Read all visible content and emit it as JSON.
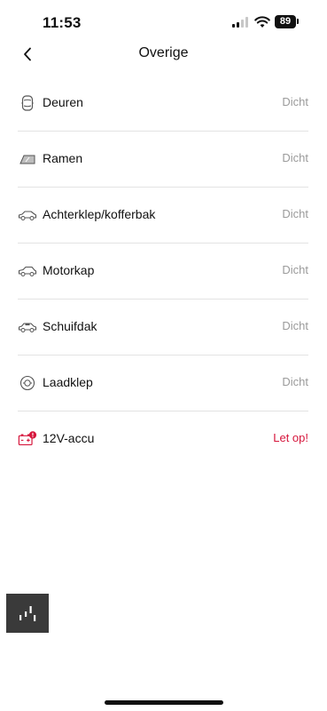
{
  "status_bar": {
    "time": "11:53",
    "battery": "89"
  },
  "header": {
    "title": "Overige"
  },
  "items": [
    {
      "label": "Deuren",
      "status": "Dicht",
      "icon": "car-doors-icon"
    },
    {
      "label": "Ramen",
      "status": "Dicht",
      "icon": "car-window-icon"
    },
    {
      "label": "Achterklep/kofferbak",
      "status": "Dicht",
      "icon": "car-tailgate-icon"
    },
    {
      "label": "Motorkap",
      "status": "Dicht",
      "icon": "car-hood-icon"
    },
    {
      "label": "Schuifdak",
      "status": "Dicht",
      "icon": "car-sunroof-icon"
    },
    {
      "label": "Laadklep",
      "status": "Dicht",
      "icon": "charge-port-icon"
    },
    {
      "label": "12V-accu",
      "status": "Let op!",
      "icon": "battery-warning-icon"
    }
  ],
  "colors": {
    "status_default": "#9b9b9b",
    "status_alert": "#d6163c",
    "divider": "#e3e3e3",
    "widget_bg": "#3a3a3a"
  }
}
